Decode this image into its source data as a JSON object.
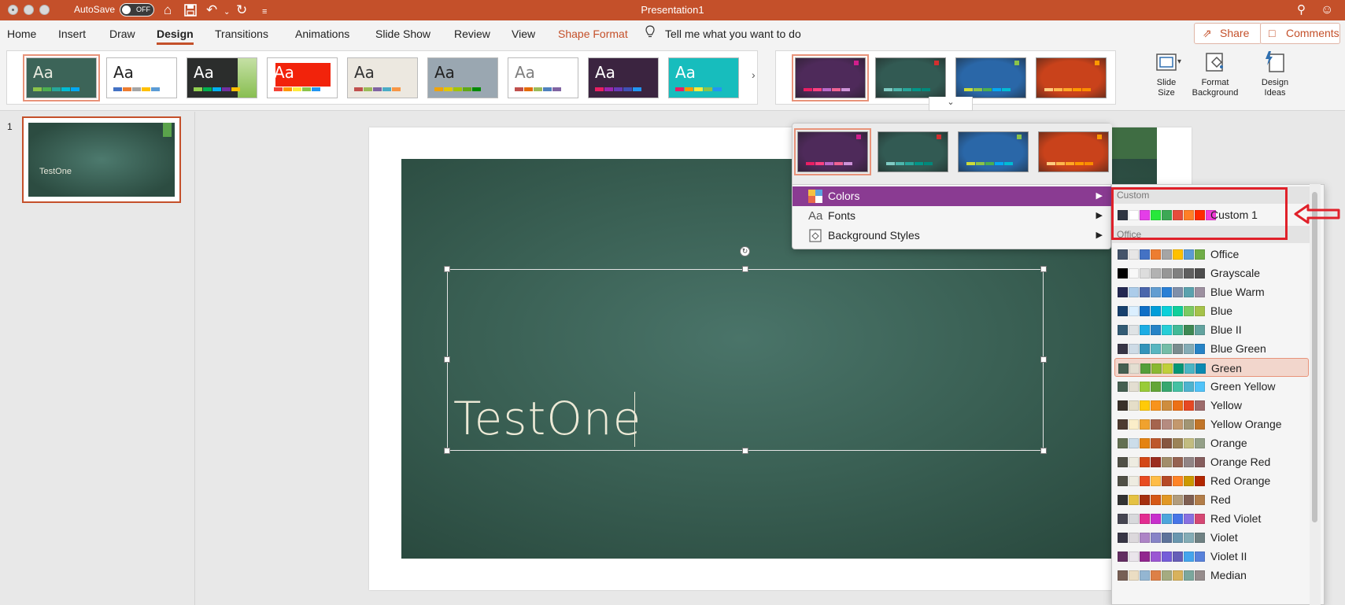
{
  "window": {
    "title": "Presentation1",
    "autosave_label": "AutoSave",
    "autosave_state": "OFF"
  },
  "tabs": [
    "Home",
    "Insert",
    "Draw",
    "Design",
    "Transitions",
    "Animations",
    "Slide Show",
    "Review",
    "View",
    "Shape Format"
  ],
  "active_tab": "Design",
  "tell_me": "Tell me what you want to do",
  "share_label": "Share",
  "comments_label": "Comments",
  "themes": [
    {
      "bg": "#3c6458",
      "fg": "#e8eadf",
      "bar": [
        "#8bc34a",
        "#4caf50",
        "#26a69a",
        "#00bcd4",
        "#03a9f4"
      ]
    },
    {
      "bg": "#ffffff",
      "fg": "#222222",
      "bar": [
        "#4472c4",
        "#ed7d31",
        "#a5a5a5",
        "#ffc000",
        "#5b9bd5"
      ]
    },
    {
      "bg": "#2b2d2c",
      "fg": "#ffffff",
      "bar": [
        "#92d050",
        "#00b050",
        "#00b0f0",
        "#7030a0",
        "#ffc000"
      ]
    },
    {
      "bg": "#ffffff",
      "fg": "#ffffff",
      "bar": [
        "#f44336",
        "#ff9800",
        "#ffeb3b",
        "#8bc34a",
        "#2196f3"
      ]
    },
    {
      "bg": "#ece8e0",
      "fg": "#333333",
      "bar": [
        "#c0504d",
        "#9bbb59",
        "#8064a2",
        "#4bacc6",
        "#f79646"
      ]
    },
    {
      "bg": "#9aa7b1",
      "fg": "#222222",
      "bar": [
        "#f0a30a",
        "#e3c800",
        "#a4c400",
        "#60a917",
        "#008a00"
      ]
    },
    {
      "bg": "#ffffff",
      "fg": "#7f7f7f",
      "bar": [
        "#c0504d",
        "#e46c0a",
        "#9bbb59",
        "#4f81bd",
        "#8064a2"
      ]
    },
    {
      "bg": "#3b2440",
      "fg": "#ffffff",
      "bar": [
        "#e91e63",
        "#9c27b0",
        "#673ab7",
        "#3f51b5",
        "#2196f3"
      ]
    },
    {
      "bg": "#17bdbd",
      "fg": "#ffffff",
      "bar": [
        "#e91e63",
        "#ff9800",
        "#ffeb3b",
        "#8bc34a",
        "#2196f3"
      ]
    }
  ],
  "variants": [
    {
      "bg": "#4e2a5a",
      "tag": "#d01e8c",
      "bar": [
        "#e91e63",
        "#ff4081",
        "#ba68c8",
        "#f06292",
        "#ce93d8"
      ]
    },
    {
      "bg": "#325a53",
      "tag": "#d32f2f",
      "bar": [
        "#80cbc4",
        "#4db6ac",
        "#26a69a",
        "#009688",
        "#00897b"
      ]
    },
    {
      "bg": "#2a67a8",
      "tag": "#8bc34a",
      "bar": [
        "#cddc39",
        "#8bc34a",
        "#4caf50",
        "#03a9f4",
        "#00bcd4"
      ]
    },
    {
      "bg": "#c9421b",
      "tag": "#ff9800",
      "bar": [
        "#ffcc80",
        "#ffb74d",
        "#ffa726",
        "#ff9800",
        "#fb8c00"
      ]
    }
  ],
  "ribbon_buttons": {
    "slide_size": "Slide\nSize",
    "format_background": "Format\nBackground",
    "design_ideas": "Design\nIdeas"
  },
  "slide": {
    "number": "1",
    "title": "TestOne"
  },
  "variant_menu": {
    "items": [
      "Colors",
      "Fonts",
      "Background Styles"
    ],
    "active": "Colors"
  },
  "colors_menu": {
    "custom_header": "Custom",
    "office_header": "Office",
    "custom": [
      {
        "name": "Custom 1",
        "swatches": [
          "#2f3542",
          "#ffffff",
          "#e43ee8",
          "#27e83b",
          "#3da855",
          "#e74c3c",
          "#ff7f27",
          "#ff2a00",
          "#f23cd8"
        ]
      }
    ],
    "office": [
      {
        "name": "Office",
        "swatches": [
          "#44546a",
          "#e7e6e6",
          "#4472c4",
          "#ed7d31",
          "#a5a5a5",
          "#ffc000",
          "#5b9bd5",
          "#70ad47"
        ]
      },
      {
        "name": "Grayscale",
        "swatches": [
          "#000000",
          "#f8f8f8",
          "#dddddd",
          "#b2b2b2",
          "#969696",
          "#808080",
          "#5f5f5f",
          "#4d4d4d"
        ]
      },
      {
        "name": "Blue Warm",
        "swatches": [
          "#242852",
          "#acccea",
          "#4a66ac",
          "#629dd1",
          "#297fd5",
          "#7f8fa9",
          "#5aa2ae",
          "#9d90a0"
        ]
      },
      {
        "name": "Blue",
        "swatches": [
          "#17406d",
          "#dbefff",
          "#0f6fc6",
          "#009dd9",
          "#0bd0d9",
          "#10cf9b",
          "#7cca62",
          "#a5c249"
        ]
      },
      {
        "name": "Blue II",
        "swatches": [
          "#335b74",
          "#dfe3e5",
          "#1cade4",
          "#2683c6",
          "#27ced7",
          "#42ba97",
          "#3e8853",
          "#62a39f"
        ]
      },
      {
        "name": "Blue Green",
        "swatches": [
          "#373545",
          "#cedbe6",
          "#3494ba",
          "#58b6c0",
          "#75bda7",
          "#7a8c8e",
          "#84acb6",
          "#2683c6"
        ]
      },
      {
        "name": "Green",
        "swatches": [
          "#455f51",
          "#e3ded1",
          "#549e39",
          "#8ab833",
          "#c0cf3a",
          "#029676",
          "#4ab5c4",
          "#0989b1"
        ]
      },
      {
        "name": "Green Yellow",
        "swatches": [
          "#455f51",
          "#e3ded1",
          "#99cb38",
          "#63a537",
          "#37a76f",
          "#44c1a3",
          "#4eb3cf",
          "#51c3f9"
        ]
      },
      {
        "name": "Yellow",
        "swatches": [
          "#39302a",
          "#e5dec8",
          "#ffca08",
          "#f8931d",
          "#ce8d3e",
          "#ec7016",
          "#e64823",
          "#9c6a6a"
        ]
      },
      {
        "name": "Yellow Orange",
        "swatches": [
          "#4e3b30",
          "#fbeec9",
          "#f0a22e",
          "#a5644e",
          "#b58b80",
          "#c3986d",
          "#a19574",
          "#c17529"
        ]
      },
      {
        "name": "Orange",
        "swatches": [
          "#637052",
          "#ccddea",
          "#e48312",
          "#bd582c",
          "#865640",
          "#9b8357",
          "#c2bc80",
          "#94a088"
        ]
      },
      {
        "name": "Orange Red",
        "swatches": [
          "#505046",
          "#eeece1",
          "#d34817",
          "#9b2d1f",
          "#a28e6a",
          "#956251",
          "#918485",
          "#855d5d"
        ]
      },
      {
        "name": "Red Orange",
        "swatches": [
          "#505046",
          "#eeece1",
          "#e84c22",
          "#ffbd47",
          "#b64926",
          "#ff8427",
          "#cc9900",
          "#b22600"
        ]
      },
      {
        "name": "Red",
        "swatches": [
          "#323232",
          "#e5c243",
          "#a5300f",
          "#d55816",
          "#e19825",
          "#b19c7d",
          "#7f5f52",
          "#b27d49"
        ]
      },
      {
        "name": "Red Violet",
        "swatches": [
          "#454551",
          "#d8d9dc",
          "#e32d91",
          "#c830cc",
          "#4ea6dc",
          "#4775e7",
          "#8971e1",
          "#d54773"
        ]
      },
      {
        "name": "Violet",
        "swatches": [
          "#373545",
          "#dcd8dc",
          "#ad84c6",
          "#8784c7",
          "#5d739a",
          "#6997af",
          "#84acb6",
          "#6f8183"
        ]
      },
      {
        "name": "Violet II",
        "swatches": [
          "#632e62",
          "#eae5eb",
          "#92278f",
          "#9b57d3",
          "#755dd9",
          "#665eb8",
          "#45a5ed",
          "#5982db"
        ]
      },
      {
        "name": "Median",
        "swatches": [
          "#775f55",
          "#ebddc3",
          "#94b6d2",
          "#dd8047",
          "#a5ab81",
          "#d8b25c",
          "#7ba79d",
          "#968c8c"
        ]
      }
    ],
    "selected": "Green"
  }
}
